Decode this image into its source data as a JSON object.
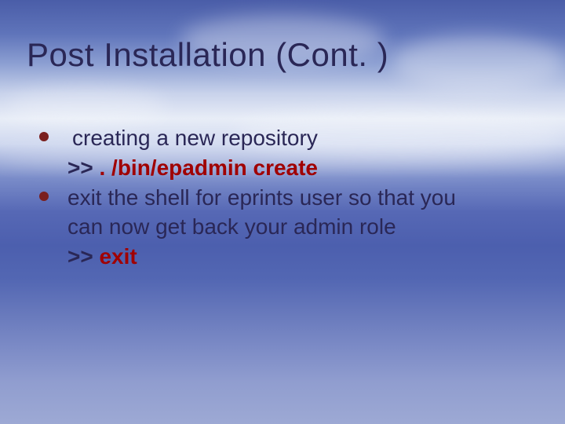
{
  "title": "Post Installation (Cont. )",
  "bullet1": {
    "text": "creating a new repository",
    "prompt": ">>",
    "cmd": ". /bin/epadmin create"
  },
  "bullet2": {
    "line1": "exit the shell for eprints user so that you",
    "line2": "can now get back your admin role",
    "prompt": ">>",
    "cmd": "exit"
  }
}
